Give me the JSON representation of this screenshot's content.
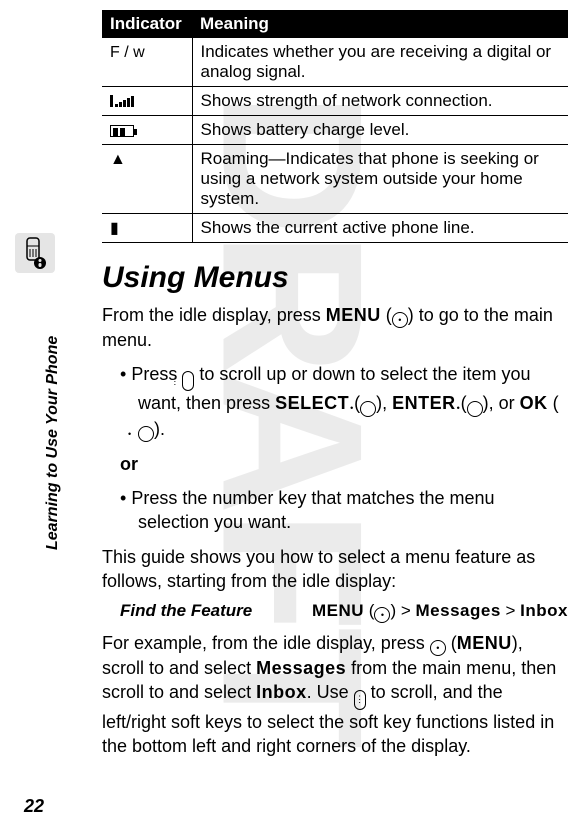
{
  "watermark": "DRAFT",
  "sideLabel": "Learning to Use Your Phone",
  "pageNumber": "22",
  "table": {
    "headers": {
      "col1": "Indicator",
      "col2": "Meaning"
    },
    "rows": [
      {
        "icon": "F / w",
        "meaning": "Indicates whether you are receiving a digital or analog signal."
      },
      {
        "icon": "signal",
        "meaning": "Shows strength of network connection."
      },
      {
        "icon": "battery",
        "meaning": "Shows battery charge level."
      },
      {
        "icon": "▲",
        "meaning": "Roaming—Indicates that phone is seeking or using a network system outside your home system."
      },
      {
        "icon": "▮",
        "meaning": "Shows the current active phone line."
      }
    ]
  },
  "heading": "Using Menus",
  "intro": {
    "pre": "From the idle display, press ",
    "menu": "MENU",
    "post": " to go to the main menu."
  },
  "bullets": {
    "b1": {
      "pre": "Press ",
      "mid": " to scroll up or down to select the item you want, then press ",
      "select": "SELECT",
      "enter": "ENTER",
      "or": ", or ",
      "ok": "OK",
      "end": "."
    },
    "orText": "or",
    "b2": "Press the number key that matches the menu selection you want."
  },
  "guide": "This guide shows you how to select a menu feature as follows, starting from the idle display:",
  "feature": {
    "label": "Find the Feature",
    "menu": "MENU",
    "gt": " >  ",
    "messages": "Messages",
    "inbox": "Inbox"
  },
  "example": {
    "p1": "For example, from the idle display, press ",
    "p2": "MENU",
    "p3": "), scroll to and select ",
    "messages": "Messages",
    "p4": " from the main menu, then scroll to and select ",
    "inbox": "Inbox",
    "p5": ". Use ",
    "p6": " to scroll, and the left/right soft keys to select the soft key functions listed in the bottom left and right corners of the display."
  }
}
